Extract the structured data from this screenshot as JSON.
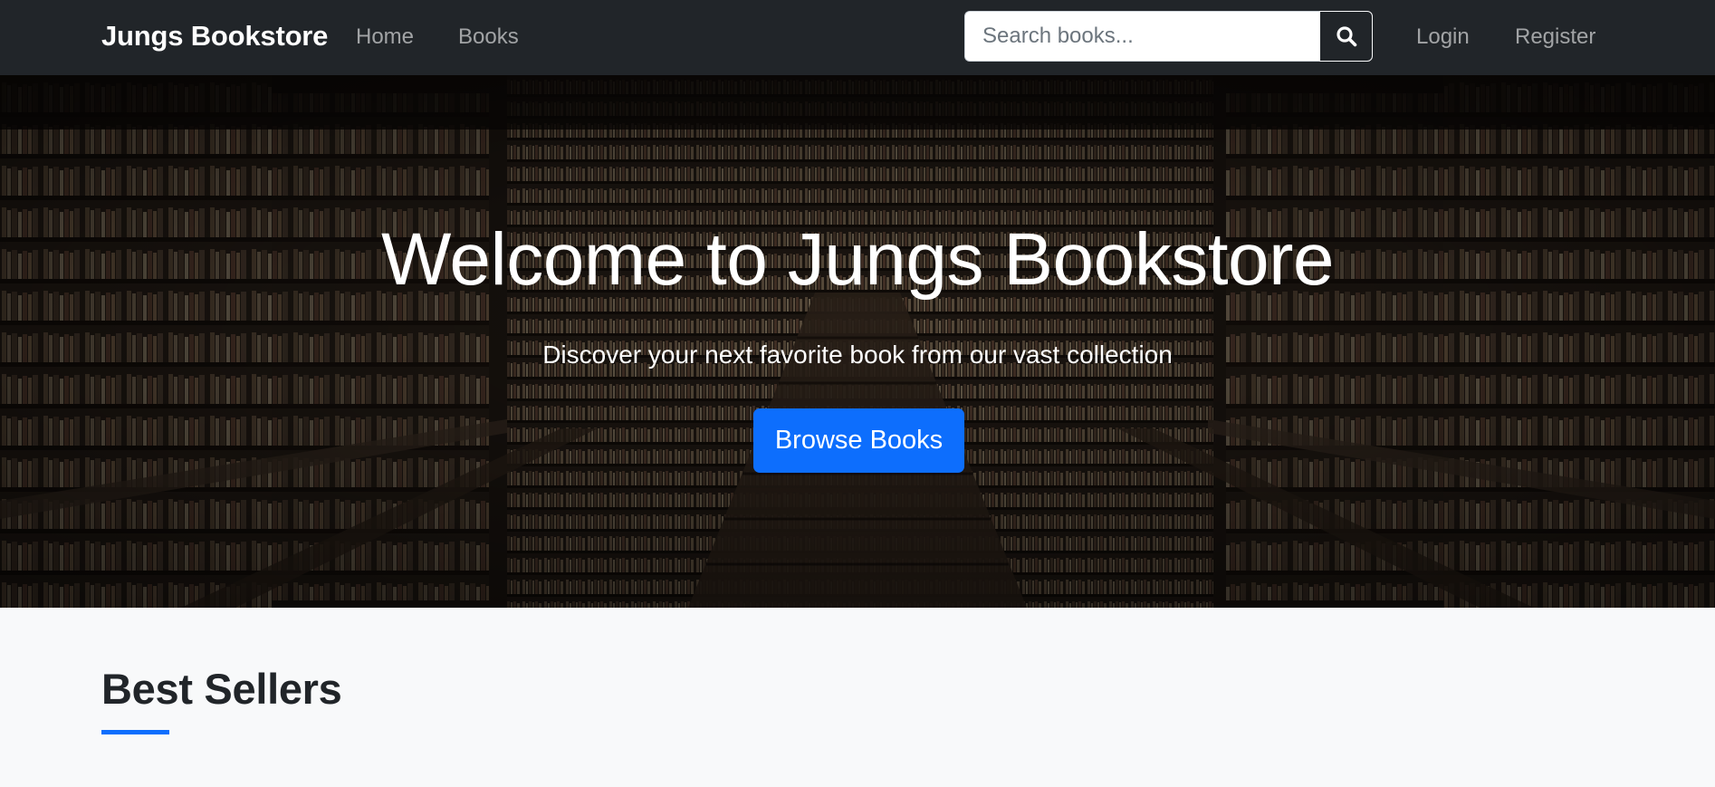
{
  "navbar": {
    "brand": "Jungs Bookstore",
    "links": [
      "Home",
      "Books"
    ],
    "search": {
      "placeholder": "Search books...",
      "value": "",
      "icon": "search-icon"
    },
    "auth": [
      "Login",
      "Register"
    ]
  },
  "hero": {
    "title": "Welcome to Jungs Bookstore",
    "subtitle": "Discover your next favorite book from our vast collection",
    "cta_label": "Browse Books"
  },
  "best_sellers": {
    "title": "Best Sellers"
  },
  "colors": {
    "navbar_bg": "#212529",
    "accent": "#0d6efd",
    "page_bg": "#f8f9fa"
  }
}
